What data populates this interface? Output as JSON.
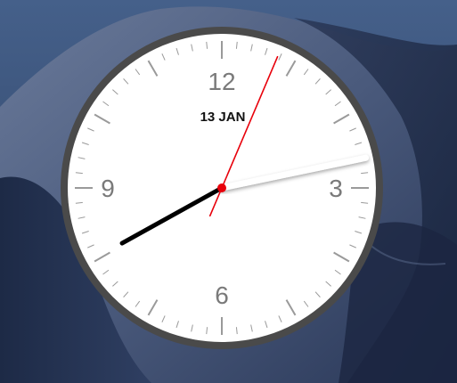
{
  "clock": {
    "date_label": "13 JAN",
    "numerals": [
      "12",
      "3",
      "6",
      "9"
    ],
    "time_shown": {
      "hours": 8,
      "minutes": 14,
      "seconds": 2
    }
  },
  "colors": {
    "face": "#ffffff",
    "bezel": "#4a4a4a",
    "numerals": "#7a7a7a",
    "ticks": "#9a9a9a",
    "hour_hand": "#000000",
    "minute_hand": "#ffffff",
    "second_hand": "#e8000b",
    "date_text": "#111111"
  },
  "wallpaper": {
    "name": "desert-dunes-night",
    "sky": "#3b5272",
    "dune_dark": "#1c2a45",
    "dune_light": "#5a6b8c"
  }
}
